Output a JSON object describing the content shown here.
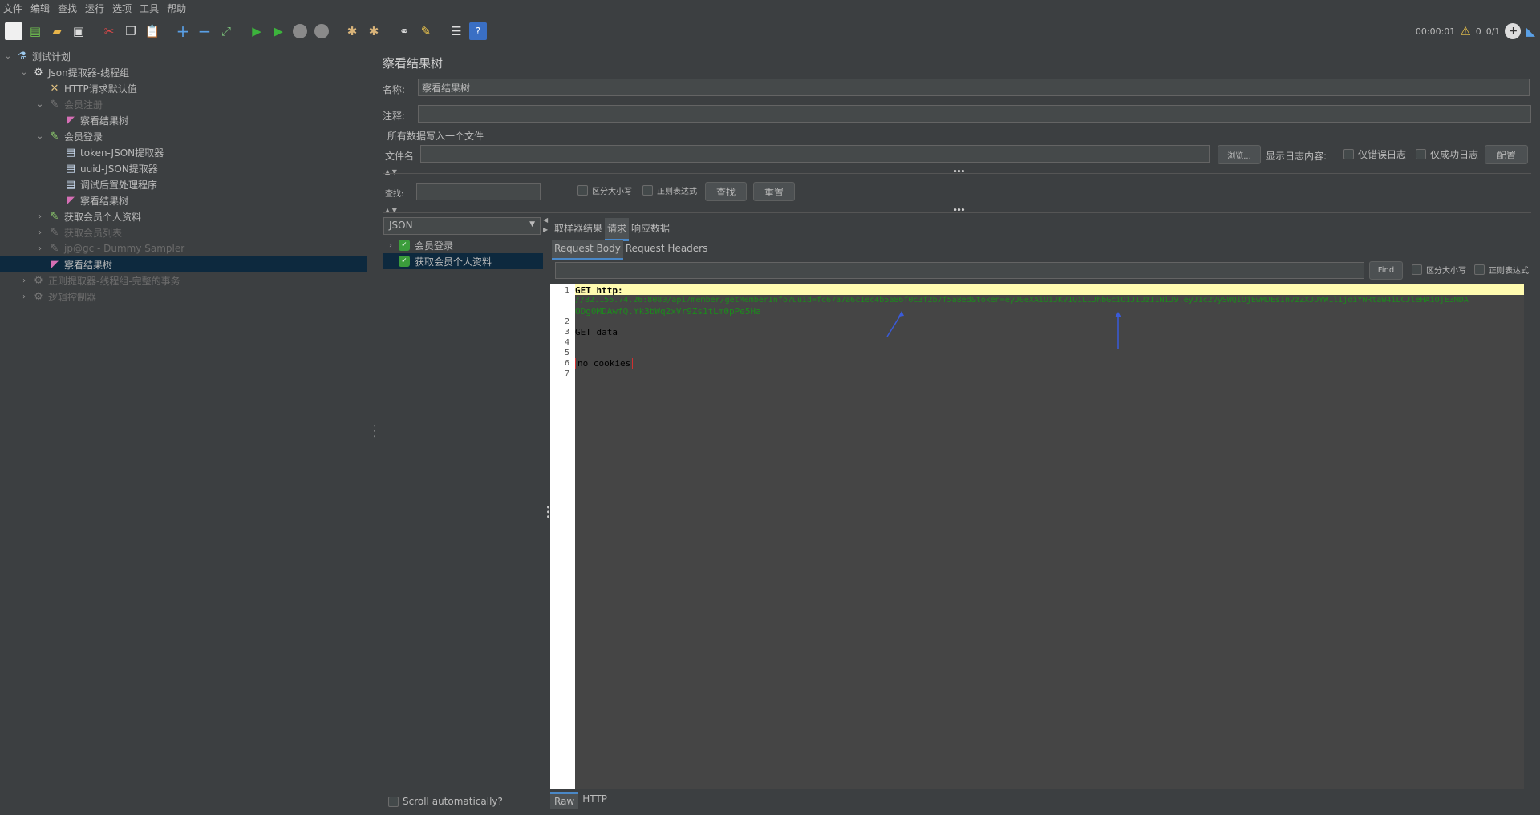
{
  "menu": [
    "文件",
    "编辑",
    "查找",
    "运行",
    "选项",
    "工具",
    "帮助"
  ],
  "toolbar": {
    "icons": [
      "new-icon",
      "templates-icon",
      "open-icon",
      "save-icon",
      "cut-icon",
      "copy-icon",
      "paste-icon",
      "expand-icon",
      "collapse-icon",
      "toggle-icon",
      "start-icon",
      "start-no-pause-icon",
      "stop-icon",
      "shutdown-icon",
      "clear-icon",
      "clear-all-icon",
      "search-icon",
      "reset-search-icon",
      "function-helper-icon",
      "help-icon"
    ],
    "timer": "00:00:01",
    "warnings": "0",
    "threads": "0/1"
  },
  "tree": [
    {
      "label": "测试计划",
      "icon": "flask-icon",
      "indent": 0,
      "arrow": "v",
      "state": "normal"
    },
    {
      "label": "Json提取器-线程组",
      "icon": "gear-icon",
      "indent": 1,
      "arrow": "v",
      "state": "normal"
    },
    {
      "label": "HTTP请求默认值",
      "icon": "wrench-icon",
      "indent": 2,
      "arrow": "",
      "state": "normal"
    },
    {
      "label": "会员注册",
      "icon": "pipette-icon",
      "indent": 2,
      "arrow": "v",
      "state": "dim"
    },
    {
      "label": "察看结果树",
      "icon": "chart-icon",
      "indent": 3,
      "arrow": "",
      "state": "normal"
    },
    {
      "label": "会员登录",
      "icon": "pipette-icon",
      "indent": 2,
      "arrow": "v",
      "state": "normal"
    },
    {
      "label": "token-JSON提取器",
      "icon": "doc-icon",
      "indent": 3,
      "arrow": "",
      "state": "normal"
    },
    {
      "label": "uuid-JSON提取器",
      "icon": "doc-icon",
      "indent": 3,
      "arrow": "",
      "state": "normal"
    },
    {
      "label": "调试后置处理程序",
      "icon": "doc-icon",
      "indent": 3,
      "arrow": "",
      "state": "normal"
    },
    {
      "label": "察看结果树",
      "icon": "chart-icon",
      "indent": 3,
      "arrow": "",
      "state": "normal"
    },
    {
      "label": "获取会员个人资料",
      "icon": "pipette-icon",
      "indent": 2,
      "arrow": ">",
      "state": "normal"
    },
    {
      "label": "获取会员列表",
      "icon": "pipette-icon",
      "indent": 2,
      "arrow": ">",
      "state": "dim"
    },
    {
      "label": "jp@gc - Dummy Sampler",
      "icon": "pipette-icon",
      "indent": 2,
      "arrow": ">",
      "state": "dim"
    },
    {
      "label": "察看结果树",
      "icon": "chart-icon",
      "indent": 2,
      "arrow": "",
      "state": "selected"
    },
    {
      "label": "正则提取器-线程组-完整的事务",
      "icon": "gear-icon",
      "indent": 1,
      "arrow": ">",
      "state": "dim"
    },
    {
      "label": "逻辑控制器",
      "icon": "gear-icon",
      "indent": 1,
      "arrow": ">",
      "state": "dim"
    }
  ],
  "panel": {
    "title": "察看结果树",
    "name_label": "名称:",
    "name_value": "察看结果树",
    "comment_label": "注释:",
    "comment_value": "",
    "file_group_label": "所有数据写入一个文件",
    "filename_label": "文件名",
    "filename_value": "",
    "browse_button": "浏览...",
    "log_label": "显示日志内容:",
    "errors_only": "仅错误日志",
    "success_only": "仅成功日志",
    "config_button": "配置",
    "search_label": "查找:",
    "search_value": "",
    "case_sensitive": "区分大小写",
    "regex": "正则表达式",
    "find_button": "查找",
    "reset_button": "重置"
  },
  "renderer": {
    "selected": "JSON"
  },
  "samples": [
    {
      "label": "会员登录",
      "arrow": ">",
      "selected": false
    },
    {
      "label": "获取会员个人资料",
      "arrow": "",
      "selected": true
    }
  ],
  "scroll_auto": "Scroll automatically?",
  "result_tabs": [
    "取样器结果",
    "请求",
    "响应数据"
  ],
  "active_result_tab": 1,
  "request_tabs": [
    "Request Body",
    "Request Headers"
  ],
  "request_search": {
    "value": "",
    "find_button": "Find",
    "case_sensitive": "区分大小写",
    "regex": "正则表达式"
  },
  "code": {
    "line_numbers": [
      "1",
      "",
      "",
      "2",
      "3",
      "4",
      "5",
      "6",
      "7"
    ],
    "lines": [
      {
        "text": "GET http:",
        "color": "#000000"
      },
      {
        "text": "//82.156.74.26:8080/api/member/getMemberInfo?uuid=fc67a7a6c1ec4b5a86f0c3f2b7f5a8ed&token=eyJ0eXAiOiJKV1QiLCJhbGciOiJIUzI1NiJ9.eyJ1c2VySWQiOjEwMDEsInVzZXJOYW1lIjoiYWRtaW4iLCJleHAiOjE3MDA",
        "color": "#1c8a1c"
      },
      {
        "text": "ODg0MDAwfQ.Yk3bWq2xVr9Zs1tLm0pPe5Ha",
        "color": "#1c8a1c"
      },
      {
        "text": "",
        "color": "#000000"
      },
      {
        "text": "GET data",
        "color": "#000000"
      },
      {
        "text": "",
        "color": "#000000"
      },
      {
        "text": "",
        "color": "#000000"
      },
      {
        "text": "no cookies",
        "color": "#000000"
      },
      {
        "text": "",
        "color": "#000000"
      }
    ]
  },
  "bottom_tabs": [
    "Raw",
    "HTTP"
  ],
  "colors": {
    "background": "#3c3f41",
    "selection": "#0d293e",
    "accent": "#4a88c7",
    "code_green": "#1c8a1c",
    "line_highlight": "#fffbb0"
  }
}
